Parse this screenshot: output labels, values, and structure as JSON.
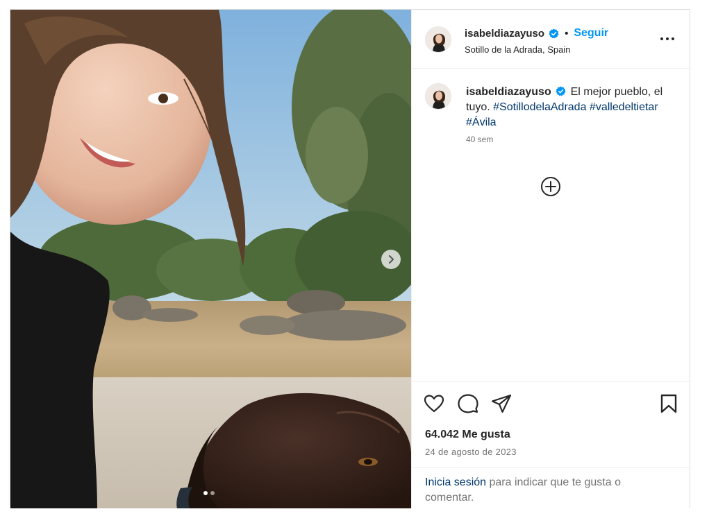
{
  "post": {
    "username": "isabeldiazayuso",
    "follow_label": "Seguir",
    "separator": "•",
    "location": "Sotillo de la Adrada, Spain",
    "caption": {
      "username": "isabeldiazayuso",
      "text": "El mejor pueblo, el tuyo.",
      "hashtags": [
        "#SotillodelaAdrada",
        "#valledeltietar",
        "#Ávila"
      ],
      "time": "40 sem"
    },
    "likes": "64.042 Me gusta",
    "date": "24 de agosto de 2023",
    "login": {
      "link": "Inicia sesión",
      "text": "para indicar que te gusta o comentar."
    },
    "carousel": {
      "current": 1,
      "total": 2
    }
  },
  "icons": {
    "verified": "verified-badge-icon",
    "more": "more-options-icon",
    "add_comment": "add-circle-icon",
    "like": "heart-icon",
    "comment": "comment-bubble-icon",
    "share": "paper-plane-icon",
    "save": "bookmark-icon",
    "next": "chevron-right-icon"
  },
  "colors": {
    "accent": "#0095f6",
    "link": "#00376b",
    "muted": "#737373",
    "verified": "#0095f6"
  }
}
